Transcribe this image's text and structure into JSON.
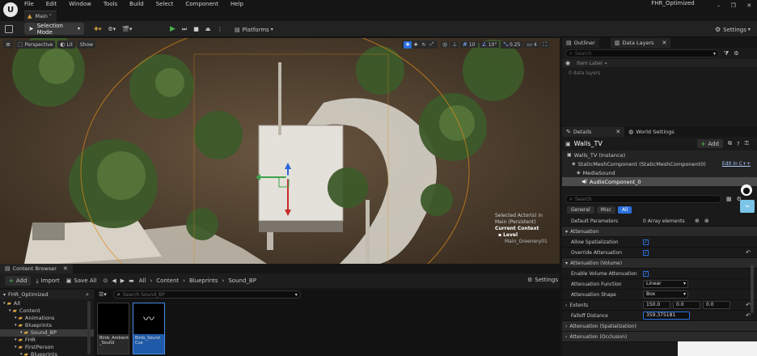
{
  "menu": [
    "File",
    "Edit",
    "Window",
    "Tools",
    "Build",
    "Select",
    "Component",
    "Help"
  ],
  "window": {
    "tab_label": "Main",
    "project_name": "FHR_Optimized"
  },
  "toolbar": {
    "selection_mode": "Selection Mode",
    "platforms": "Platforms",
    "settings": "Settings"
  },
  "viewport": {
    "perspective": "Perspective",
    "lit": "Lit",
    "show": "Show",
    "grid_snap": "10",
    "rot_snap": "10°",
    "scale_snap": "0.25",
    "cam_speed": "4",
    "overlay_selected": "Selected Actor(s) in",
    "overlay_level_name": "Main (Persistent)",
    "overlay_current_context": "Current Context",
    "overlay_level_label": "Level",
    "overlay_level_value": "Main_Greenery01"
  },
  "content_browser": {
    "tab_label": "Content Browser",
    "add": "Add",
    "import": "Import",
    "save_all": "Save All",
    "breadcrumb": [
      "All",
      "Content",
      "Blueprints",
      "Sound_BP"
    ],
    "settings": "Settings",
    "search_placeholder": "Search Sound_BP",
    "tree_root": "FHR_Optimized",
    "tree": [
      {
        "label": "All",
        "depth": 0
      },
      {
        "label": "Content",
        "depth": 1
      },
      {
        "label": "Animations",
        "depth": 2
      },
      {
        "label": "Blueprints",
        "depth": 2
      },
      {
        "label": "Sound_BP",
        "depth": 3,
        "selected": true
      },
      {
        "label": "FHR",
        "depth": 2
      },
      {
        "label": "FirstPerson",
        "depth": 2
      },
      {
        "label": "Blueprints",
        "depth": 3
      }
    ],
    "assets": [
      {
        "label": "Birds_Ambient_Sound",
        "line1": "Birds_Ambient",
        "line2": "_Sound",
        "selected": false
      },
      {
        "label": "Birds_Sound_Cue",
        "line1": "Birds_Sound",
        "line2": "Cue",
        "selected": true
      }
    ]
  },
  "outliner": {
    "tab_outliner": "Outliner",
    "tab_data_layers": "Data Layers",
    "search_placeholder": "Search",
    "column_item_label": "Item Label",
    "empty_text": "0 data layers"
  },
  "details": {
    "tab_details": "Details",
    "tab_world_settings": "World Settings",
    "actor_name": "Walls_TV",
    "add": "Add",
    "components": [
      {
        "label": "Walls_TV (Instance)",
        "depth": 0
      },
      {
        "label": "StaticMeshComponent (StaticMeshComponent0)",
        "depth": 1,
        "link": "Edit in C++"
      },
      {
        "label": "MediaSound",
        "depth": 2
      },
      {
        "label": "AudioComponent_0",
        "depth": 3,
        "selected": true
      }
    ],
    "search_placeholder": "Search",
    "filters": [
      "General",
      "Misc",
      "All"
    ],
    "active_filter": "All",
    "default_parameters": "Default Parameters",
    "array_elements": "0 Array elements",
    "sections": {
      "attenuation": "Attenuation",
      "attenuation_volume": "Attenuation (Volume)",
      "attenuation_spatialization": "Attenuation (Spatialization)",
      "attenuation_occlusion": "Attenuation (Occlusion)"
    },
    "props": {
      "allow_spatialization": "Allow Spatialization",
      "override_attenuation": "Override Attenuation",
      "enable_volume_attenuation": "Enable Volume Attenuation",
      "attenuation_function": "Attenuation Function",
      "attenuation_function_value": "Linear",
      "attenuation_shape": "Attenuation Shape",
      "attenuation_shape_value": "Box",
      "extents": "Extents",
      "extents_x": "150.0",
      "extents_y": "0.0",
      "extents_z": "0.0",
      "falloff_distance": "Falloff Distance",
      "falloff_distance_value": "359.375181"
    }
  },
  "colors": {
    "accent_blue": "#2a6fdc",
    "selection_blue": "#1f5aa8",
    "play_green": "#4caf50",
    "folder_yellow": "#d9a441"
  }
}
